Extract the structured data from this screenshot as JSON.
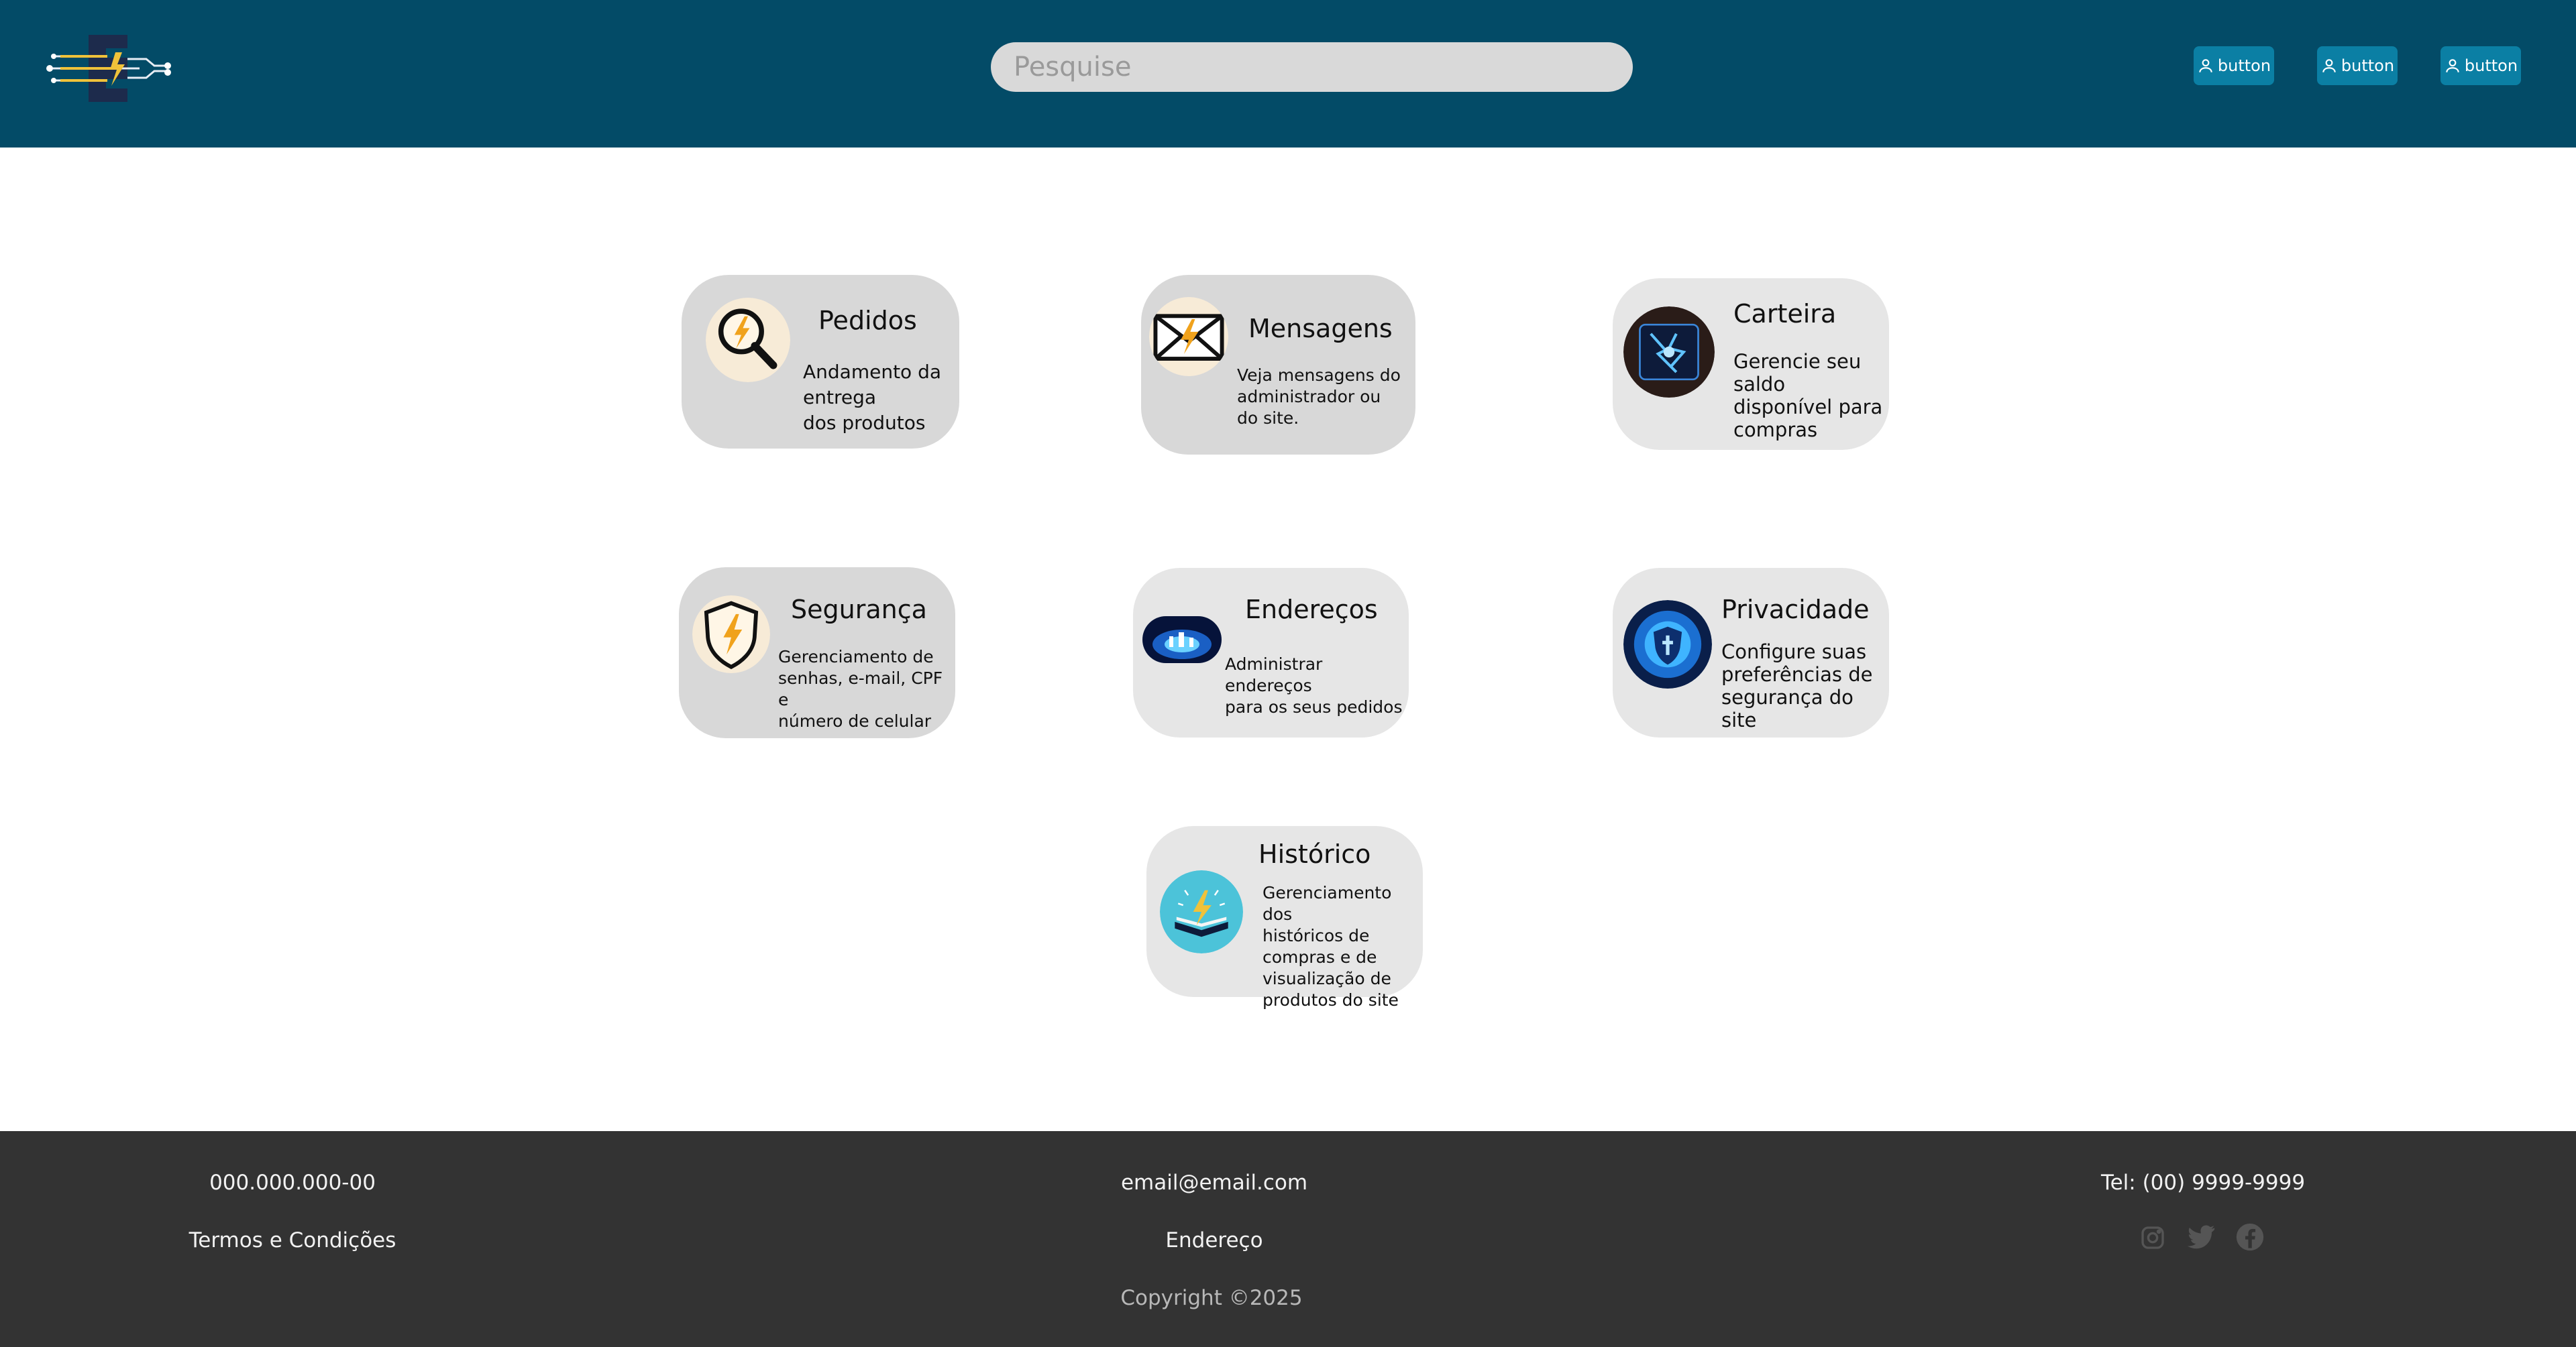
{
  "header": {
    "logo": "ec-circuit-logo",
    "search_placeholder": "Pesquise",
    "buttons": [
      {
        "label": "button",
        "icon": "user-icon"
      },
      {
        "label": "button",
        "icon": "user-icon"
      },
      {
        "label": "button",
        "icon": "user-icon"
      }
    ]
  },
  "cards": [
    {
      "title": "Pedidos",
      "desc": [
        "Andamento da",
        "entrega",
        "dos produtos"
      ],
      "icon": "magnifier-lightning-icon"
    },
    {
      "title": "Mensagens",
      "desc": [
        "Veja mensagens do",
        "administrador ou",
        "do site."
      ],
      "icon": "envelope-lightning-icon"
    },
    {
      "title": "Carteira",
      "desc": [
        "Gerencie seu",
        "saldo",
        "disponível para",
        "compras"
      ],
      "icon": "wallet-lightning-icon"
    },
    {
      "title": "Segurança",
      "desc": [
        "Gerenciamento de",
        "senhas, e-mail, CPF e",
        "número de celular"
      ],
      "icon": "shield-lightning-icon"
    },
    {
      "title": "Endereços",
      "desc": [
        "Administrar endereços",
        "para os seus pedidos"
      ],
      "icon": "city-map-icon"
    },
    {
      "title": "Privacidade",
      "desc": [
        "Configure suas",
        "preferências de",
        "segurança do",
        "site"
      ],
      "icon": "privacy-shield-icon"
    },
    {
      "title": "Histórico",
      "desc": [
        "Gerenciamento dos",
        "históricos de",
        "compras e de",
        "visualização de",
        "produtos do site"
      ],
      "icon": "history-book-icon"
    }
  ],
  "footer": {
    "cpf": "000.000.000-00",
    "terms": "Termos e Condições",
    "email": "email@email.com",
    "address": "Endereço",
    "copyright": "Copyright ©2025",
    "phone": "Tel: (00) 9999-9999",
    "social": [
      "instagram-icon",
      "twitter-icon",
      "facebook-icon"
    ]
  },
  "colors": {
    "header_bg": "#034b67",
    "header_button": "#0b7fa4",
    "search_bg": "#d9d9d9",
    "card_dark": "#d8d8d8",
    "card_light": "#e6e6e6",
    "footer_bg": "#333333",
    "accent_gold": "#f0a21c"
  }
}
